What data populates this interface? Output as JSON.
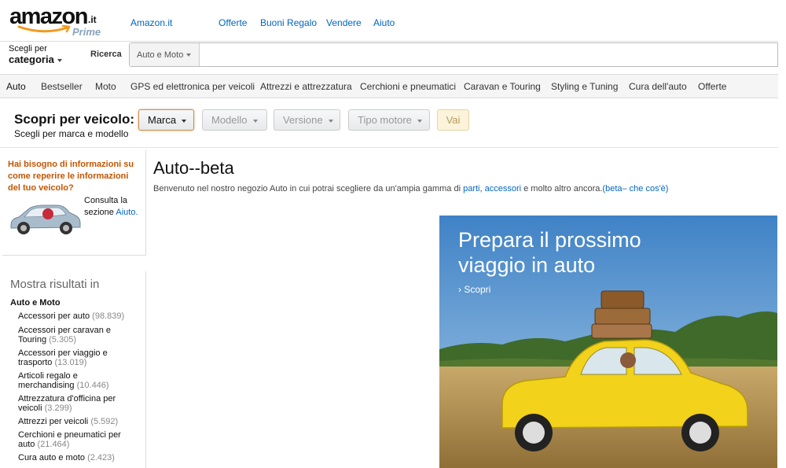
{
  "logo": {
    "word": "amazon",
    "tld": ".it",
    "prime": "Prime"
  },
  "top_links": [
    "Amazon.it",
    "Offerte",
    "Buoni Regalo",
    "Vendere",
    "Aiuto"
  ],
  "search": {
    "category_small": "Scegli per",
    "category_big": "categoria",
    "label": "Ricerca",
    "scope": "Auto e Moto",
    "value": ""
  },
  "subnav": [
    "Auto",
    "Bestseller",
    "Moto",
    "GPS ed elettronica per veicoli",
    "Attrezzi e attrezzatura",
    "Cerchioni e pneumatici",
    "Caravan e Touring",
    "Styling e Tuning",
    "Cura dell'auto",
    "Offerte"
  ],
  "vehicle": {
    "title": "Scopri per veicolo:",
    "subtitle": "Scegli per marca e modello",
    "selects": [
      "Marca",
      "Modello",
      "Versione",
      "Tipo motore"
    ],
    "go": "Vai"
  },
  "help": {
    "title": "Hai bisogno di informazioni su come reperire le informazioni del tuo veicolo?",
    "text": "Consulta la sezione",
    "link": "Aiuto."
  },
  "results": {
    "title": "Mostra risultati in",
    "category": "Auto e Moto",
    "items": [
      {
        "label": "Accessori per auto",
        "count": "(98.839)"
      },
      {
        "label": "Accessori per caravan e Touring",
        "count": "(5.305)"
      },
      {
        "label": "Accessori per viaggio e trasporto",
        "count": "(13.019)"
      },
      {
        "label": "Articoli regalo e merchandising",
        "count": "(10.446)"
      },
      {
        "label": "Attrezzatura d'officina per veicoli",
        "count": "(3.299)"
      },
      {
        "label": "Attrezzi per veicoli",
        "count": "(5.592)"
      },
      {
        "label": "Cerchioni e pneumatici per auto",
        "count": "(21.464)"
      },
      {
        "label": "Cura auto e moto",
        "count": "(2.423)"
      }
    ]
  },
  "main": {
    "title": "Auto--beta",
    "welcome_pre": "Benvenuto nel nostro negozio Auto in cui potrai scegliere da un'ampia gamma di ",
    "link_parti": "parti",
    "sep": ", ",
    "link_accessori": "accessori",
    "welcome_post": " e molto altro ancora.",
    "link_beta": "(beta– che cos'è)"
  },
  "banner": {
    "headline_1": "Prepara il prossimo",
    "headline_2": "viaggio in auto",
    "cta": "› Scopri"
  },
  "colors": {
    "link": "#0066c0",
    "help_orange": "#c45500",
    "car_yellow": "#f2d21a",
    "sky": "#4f8fcd"
  }
}
